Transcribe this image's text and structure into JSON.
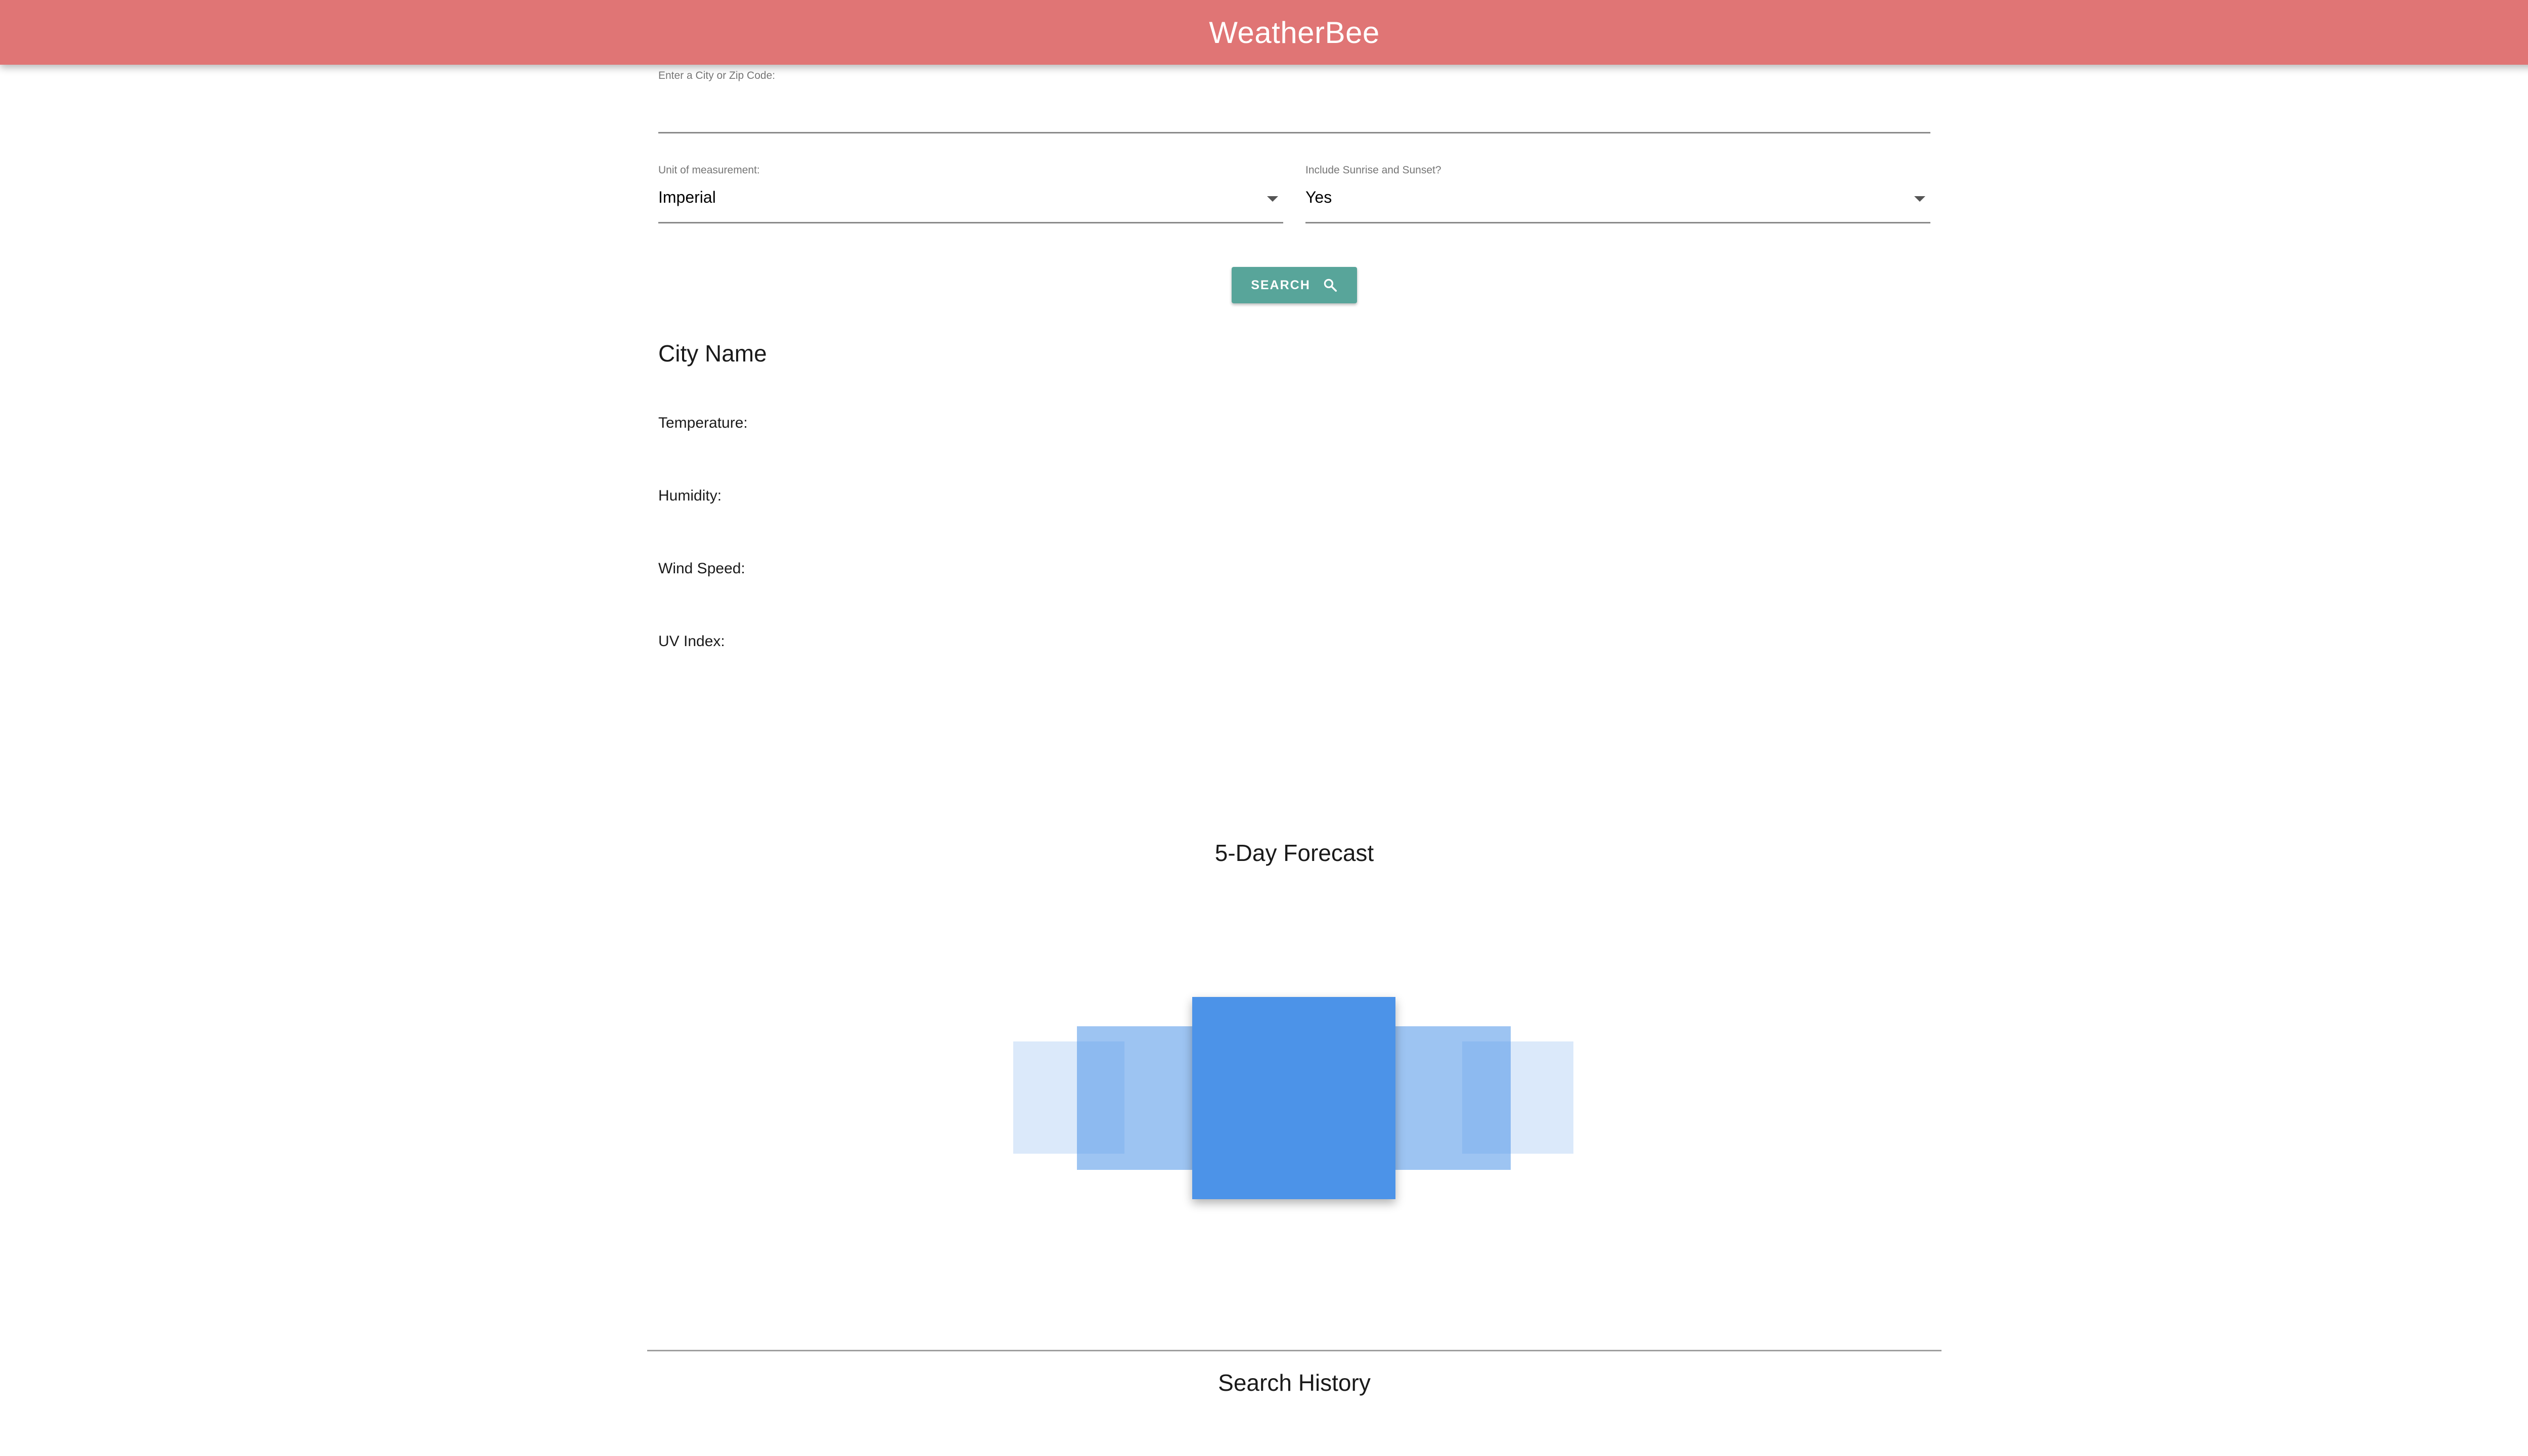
{
  "app": {
    "title": "WeatherBee",
    "accent_color": "#e07575"
  },
  "search_form": {
    "city_input": {
      "label": "Enter a City or Zip Code:",
      "value": "",
      "placeholder": ""
    },
    "unit_select": {
      "label": "Unit of measurement:",
      "selected": "Imperial"
    },
    "sun_select": {
      "label": "Include Sunrise and Sunset?",
      "selected": "Yes"
    },
    "search_button": {
      "label": "SEARCH",
      "icon": "search-icon",
      "color": "#58a59a"
    }
  },
  "current_weather": {
    "city_name": "City Name",
    "temperature_label": "Temperature:",
    "humidity_label": "Humidity:",
    "wind_speed_label": "Wind Speed:",
    "uv_index_label": "UV Index:"
  },
  "forecast": {
    "title": "5-Day Forecast",
    "card_color": "#4c93e8",
    "card_count": 5,
    "active_index": 2
  },
  "history": {
    "title": "Search History"
  }
}
